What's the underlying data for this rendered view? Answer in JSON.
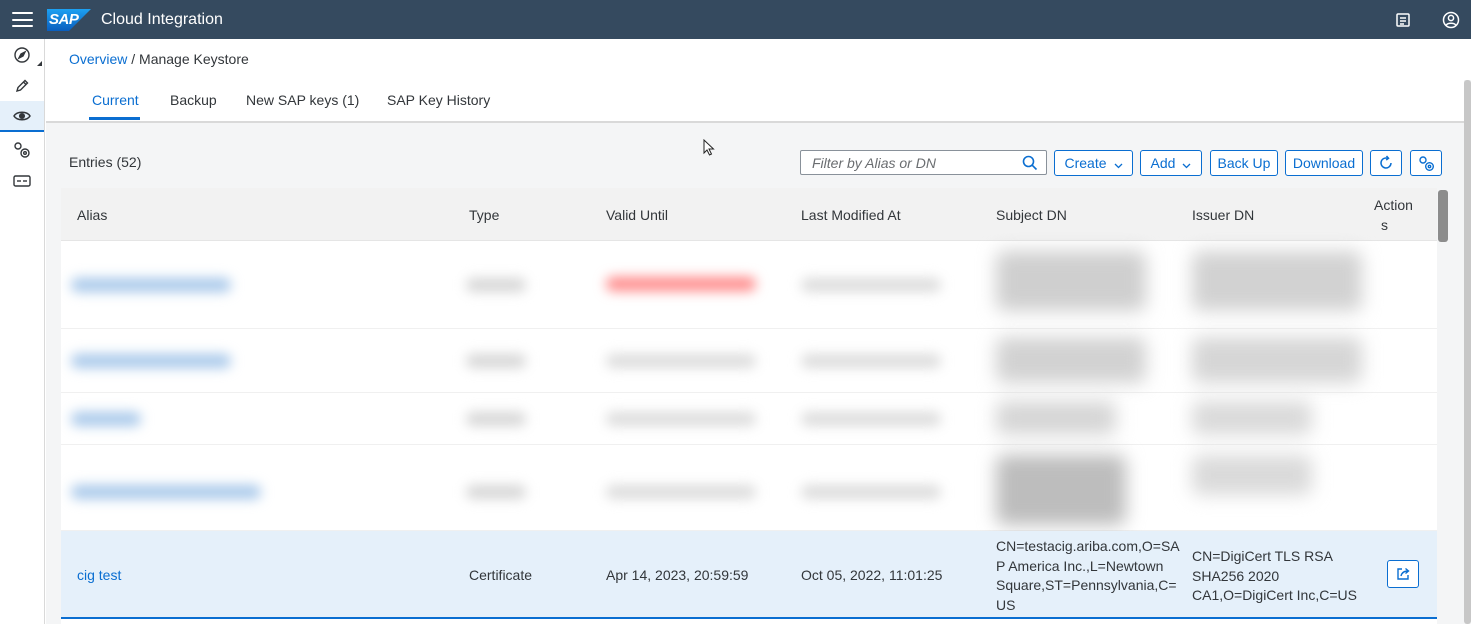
{
  "shell": {
    "logo_text": "SAP",
    "title": "Cloud Integration"
  },
  "sidenav": {
    "items": [
      "discover-icon",
      "design-icon",
      "monitor-icon",
      "settings-icon",
      "api-icon"
    ],
    "active": "monitor-icon"
  },
  "breadcrumb": {
    "root": "Overview",
    "separator": "/",
    "current": "Manage Keystore"
  },
  "tabs": [
    {
      "label": "Current",
      "active": true
    },
    {
      "label": "Backup",
      "active": false
    },
    {
      "label": "New SAP keys (1)",
      "active": false
    },
    {
      "label": "SAP Key History",
      "active": false
    }
  ],
  "toolbar": {
    "entries_label": "Entries (52)",
    "filter_placeholder": "Filter by Alias or DN",
    "create_label": "Create",
    "add_label": "Add",
    "backup_label": "Back Up",
    "download_label": "Download"
  },
  "table": {
    "columns": [
      "Alias",
      "Type",
      "Valid Until",
      "Last Modified At",
      "Subject DN",
      "Issuer DN",
      "Action",
      "s"
    ],
    "selected_row": {
      "alias": "cig test",
      "type": "Certificate",
      "valid_until": "Apr 14, 2023, 20:59:59",
      "last_modified": "Oct 05, 2022, 11:01:25",
      "subject_dn_lines": [
        "CN=testacig.ariba.com,O=SA",
        "P America Inc.,L=Newtown",
        "Square,ST=Pennsylvania,C=",
        "US"
      ],
      "issuer_dn_lines": [
        "CN=DigiCert TLS RSA",
        "SHA256 2020",
        "CA1,O=DigiCert Inc,C=US"
      ]
    }
  },
  "colors": {
    "shell_bg": "#354a5f",
    "accent": "#0a6ed1",
    "selected_row_bg": "#e5f0fa",
    "blurred_expiry": "#ff8a8a"
  }
}
